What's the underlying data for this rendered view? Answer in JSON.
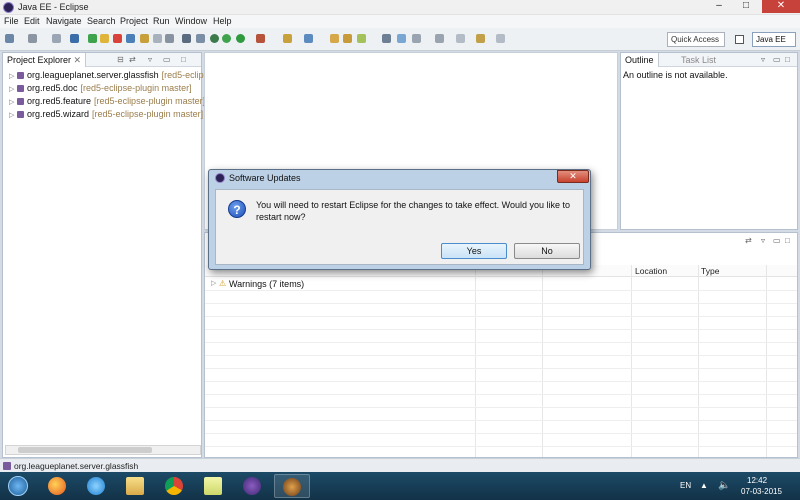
{
  "window": {
    "title": "Java EE - Eclipse",
    "minimize": "–",
    "maximize": "□",
    "close": "✕"
  },
  "menu": [
    "File",
    "Edit",
    "Navigate",
    "Search",
    "Project",
    "Run",
    "Window",
    "Help"
  ],
  "toolbar": {
    "quick_access": "Quick Access",
    "perspective": "Java EE"
  },
  "project_explorer": {
    "tab_label": "Project Explorer",
    "items": [
      {
        "name": "org.leagueplanet.server.glassfish",
        "branch": "[red5-eclipse"
      },
      {
        "name": "org.red5.doc",
        "branch": "[red5-eclipse-plugin master]"
      },
      {
        "name": "org.red5.feature",
        "branch": "[red5-eclipse-plugin master]"
      },
      {
        "name": "org.red5.wizard",
        "branch": "[red5-eclipse-plugin master]"
      }
    ]
  },
  "outline": {
    "tab_label": "Outline",
    "tasklist_label": "Task List",
    "message": "An outline is not available."
  },
  "problems": {
    "columns": [
      "Location",
      "Type"
    ],
    "rows": [
      "Warnings (7 items)"
    ]
  },
  "status": {
    "text": "org.leagueplanet.server.glassfish"
  },
  "dialog": {
    "title": "Software Updates",
    "close": "✕",
    "message": "You will need to restart Eclipse for the changes to take effect. Would you like to restart now?",
    "yes_label": "Yes",
    "no_label": "No"
  },
  "taskbar": {
    "language": "EN",
    "time": "12:42",
    "date": "07-03-2015"
  }
}
